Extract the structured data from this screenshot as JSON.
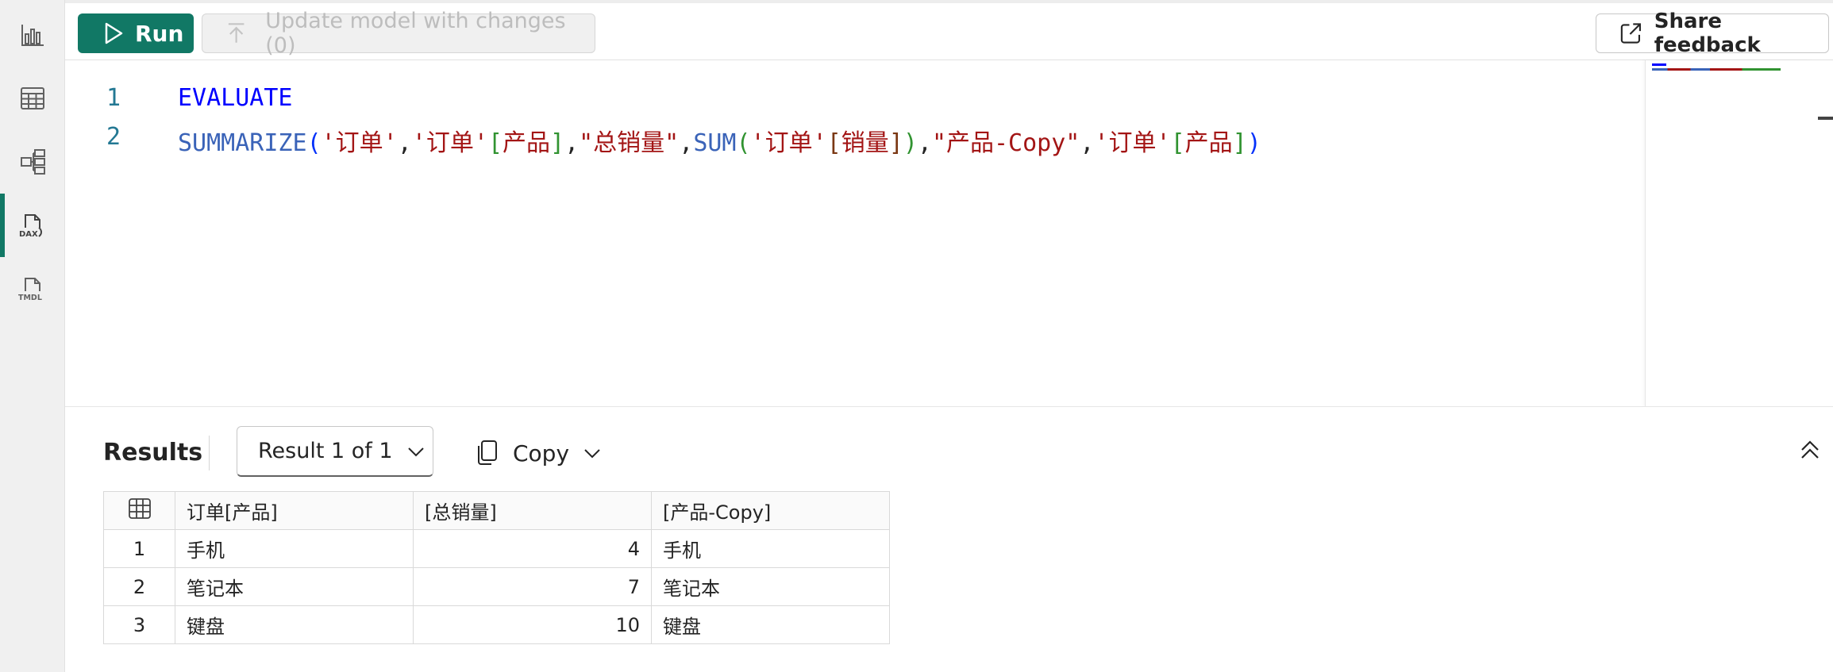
{
  "toolbar": {
    "run_label": "Run",
    "update_label": "Update model with changes (0)",
    "share_label": "Share feedback"
  },
  "rail": {
    "items": [
      {
        "icon": "report-icon"
      },
      {
        "icon": "table-icon"
      },
      {
        "icon": "model-icon"
      },
      {
        "icon": "dax-icon",
        "label": "DAX",
        "active": true
      },
      {
        "icon": "tmdl-icon",
        "label": "TMDL"
      }
    ]
  },
  "editor": {
    "line_numbers": [
      "1",
      "2"
    ],
    "line1": "EVALUATE",
    "line2_tokens": {
      "fn1": "SUMMARIZE",
      "open1": "(",
      "t1": "'订单'",
      "c1": ",",
      "t2": "'订单'",
      "ob1": "[",
      "col1": "产品",
      "cb1": "]",
      "c2": ",",
      "s1": "\"总销量\"",
      "c3": ",",
      "fn2": "SUM",
      "open2": "(",
      "t3": "'订单'",
      "ob2": "[",
      "col2": "销量",
      "cb2": "]",
      "close2": ")",
      "c4": ",",
      "s2": "\"产品-Copy\"",
      "c5": ",",
      "t4": "'订单'",
      "ob3": "[",
      "col3": "产品",
      "cb3": "]",
      "close1": ")"
    }
  },
  "results": {
    "title": "Results",
    "dropdown_label": "Result 1 of 1",
    "copy_label": "Copy",
    "columns": [
      "订单[产品]",
      "[总销量]",
      "[产品-Copy]"
    ],
    "rows": [
      {
        "index": "1",
        "product": "手机",
        "total": "4",
        "copy": "手机"
      },
      {
        "index": "2",
        "product": "笔记本",
        "total": "7",
        "copy": "笔记本"
      },
      {
        "index": "3",
        "product": "键盘",
        "total": "10",
        "copy": "键盘"
      }
    ]
  }
}
